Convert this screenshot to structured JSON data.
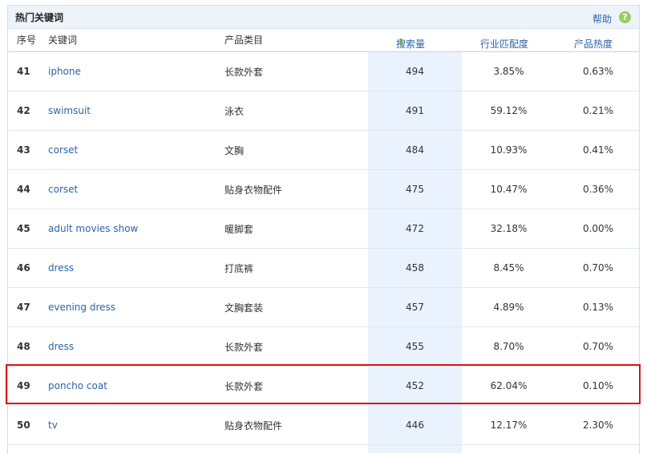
{
  "panel": {
    "title": "热门关键词",
    "help_label": "帮助",
    "help_icon": "?"
  },
  "headers": {
    "index": "序号",
    "keyword": "关键词",
    "category": "产品类目",
    "search_volume": "搜索量",
    "industry_match": "行业匹配度",
    "product_heat": "产品热度",
    "sort_arrow": "⬇"
  },
  "accent_colors": {
    "link_blue": "#2b65a8",
    "highlight_column": "#eaf2fd",
    "active_sort_arrow": "#6fb13f",
    "selection_box": "#d51818"
  },
  "rows": [
    {
      "index": "41",
      "keyword": "iphone",
      "category": "长款外套",
      "search": "494",
      "match": "3.85%",
      "heat": "0.63%"
    },
    {
      "index": "42",
      "keyword": "swimsuit",
      "category": "泳衣",
      "search": "491",
      "match": "59.12%",
      "heat": "0.21%"
    },
    {
      "index": "43",
      "keyword": "corset",
      "category": "文胸",
      "search": "484",
      "match": "10.93%",
      "heat": "0.41%"
    },
    {
      "index": "44",
      "keyword": "corset",
      "category": "贴身衣物配件",
      "search": "475",
      "match": "10.47%",
      "heat": "0.36%"
    },
    {
      "index": "45",
      "keyword": "adult movies show",
      "category": "暖脚套",
      "search": "472",
      "match": "32.18%",
      "heat": "0.00%"
    },
    {
      "index": "46",
      "keyword": "dress",
      "category": "打底裤",
      "search": "458",
      "match": "8.45%",
      "heat": "0.70%"
    },
    {
      "index": "47",
      "keyword": "evening dress",
      "category": "文胸套装",
      "search": "457",
      "match": "4.89%",
      "heat": "0.13%"
    },
    {
      "index": "48",
      "keyword": "dress",
      "category": "长款外套",
      "search": "455",
      "match": "8.70%",
      "heat": "0.70%"
    },
    {
      "index": "49",
      "keyword": "poncho coat",
      "category": "长款外套",
      "search": "452",
      "match": "62.04%",
      "heat": "0.10%"
    },
    {
      "index": "50",
      "keyword": "tv",
      "category": "贴身衣物配件",
      "search": "446",
      "match": "12.17%",
      "heat": "2.30%"
    }
  ]
}
